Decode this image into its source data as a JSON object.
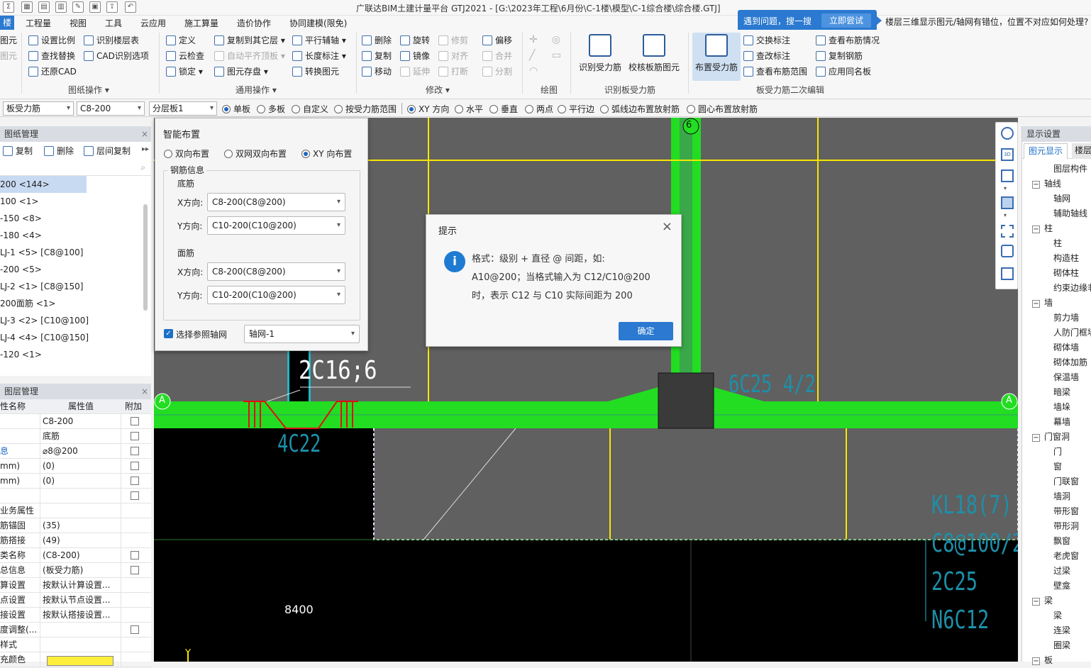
{
  "window_title": "广联达BIM土建计量平台 GTJ2021 - [G:\\2023年工程\\6月份\\C-1楼\\模型\\C-1综合楼\\综合楼.GTJ]",
  "quick_access_icons": [
    "sum-icon",
    "grid-icon",
    "table-icon",
    "table2-icon",
    "draw-icon",
    "save-icon",
    "export-icon",
    "undo-icon"
  ],
  "menu": {
    "items": [
      "楼",
      "工程量",
      "视图",
      "工具",
      "云应用",
      "施工算量",
      "造价协作",
      "协同建模(限免)"
    ]
  },
  "help_banner": {
    "text": "遇到问题，搜一搜",
    "button": "立即尝试",
    "question": "楼层三维显示图元/轴网有错位，位置不对应如何处理?"
  },
  "ribbon": {
    "left_partial": [
      "图元",
      "图元"
    ],
    "drawing_ops": {
      "items": [
        "设置比例",
        "识别楼层表",
        "查找替换",
        "CAD识别选项",
        "还原CAD"
      ],
      "label": "图纸操作"
    },
    "common_ops": {
      "items": [
        "定义",
        "复制到其它层",
        "平行辅轴",
        "云检查",
        "自动平齐顶板",
        "长度标注",
        "锁定",
        "图元存盘",
        "转换图元"
      ],
      "label": "通用操作"
    },
    "modify": {
      "items": [
        "删除",
        "旋转",
        "修剪",
        "偏移",
        "复制",
        "镜像",
        "对齐",
        "合并",
        "移动",
        "延伸",
        "打断",
        "分割"
      ],
      "label": "修改"
    },
    "draw": {
      "label": "绘图"
    },
    "identify": {
      "items": [
        "识别受力筋",
        "校核板筋图元"
      ],
      "label": "识别板受力筋"
    },
    "edit2": {
      "items": [
        "布置受力筋",
        "交换标注",
        "查看布筋情况",
        "查改标注",
        "复制钢筋",
        "查看布筋范围",
        "应用同名板"
      ],
      "label": "板受力筋二次编辑"
    }
  },
  "toolbar2": {
    "type_select": "板受力筋",
    "spec_select": "C8-200",
    "layer_select": "分层板1",
    "options": [
      "单板",
      "多板",
      "自定义",
      "按受力筋范围",
      "XY 方向",
      "水平",
      "垂直",
      "两点",
      "平行边",
      "弧线边布置放射筋",
      "圆心布置放射筋"
    ]
  },
  "drawing_mgmt": {
    "title": "图纸管理",
    "actions": [
      "复制",
      "删除",
      "层间复制"
    ],
    "items": [
      "200 <144>",
      "100 <1>",
      "-150 <8>",
      "-180 <4>",
      "LJ-1 <5> [C8@100]",
      "-200 <5>",
      "LJ-2 <1> [C8@150]",
      "200面筋 <1>",
      "LJ-3 <2> [C10@100]",
      "LJ-4 <4> [C10@150]",
      "-120 <1>"
    ]
  },
  "layer_mgmt": {
    "title": "图层管理",
    "headers": [
      "性名称",
      "属性值",
      "附加"
    ],
    "rows": [
      [
        "",
        "C8-200"
      ],
      [
        "",
        "底筋"
      ],
      [
        "息",
        "⌀8@200"
      ],
      [
        "mm)",
        "(0)"
      ],
      [
        "mm)",
        "(0)"
      ],
      [
        "",
        ""
      ],
      [
        "业务属性",
        ""
      ],
      [
        "筋锚固",
        "(35)"
      ],
      [
        "筋搭接",
        "(49)"
      ],
      [
        "类名称",
        "(C8-200)"
      ],
      [
        "总信息",
        "(板受力筋)"
      ],
      [
        "算设置",
        "按默认计算设置..."
      ],
      [
        "点设置",
        "按默认节点设置..."
      ],
      [
        "接设置",
        "按默认搭接设置..."
      ],
      [
        "度调整(...",
        ""
      ],
      [
        "样式",
        ""
      ],
      [
        "充颜色",
        ""
      ]
    ]
  },
  "smart_layout": {
    "title": "智能布置",
    "modes": [
      "双向布置",
      "双网双向布置",
      "XY 向布置"
    ],
    "rebar_info": "钢筋信息",
    "bottom": "底筋",
    "top": "面筋",
    "x_label": "X方向:",
    "y_label": "Y方向:",
    "bottom_x": "C8-200(C8@200)",
    "bottom_y": "C10-200(C10@200)",
    "top_x": "C8-200(C8@200)",
    "top_y": "C10-200(C10@200)",
    "ref_axis_label": "选择参照轴网",
    "ref_axis_value": "轴网-1"
  },
  "prompt": {
    "title": "提示",
    "line1": "格式：级别 + 直径 @ 间距，如:",
    "line2": "A10@200；当格式输入为 C12/C10@200",
    "line3": "时，表示 C12 与 C10 实际间距为 200",
    "ok": "确定"
  },
  "cad": {
    "axis_6": "6",
    "axis_a_left": "A",
    "axis_a_right": "A",
    "label_2c16": "2C16;6",
    "label_4c22": "4C22",
    "label_6c25": "6C25 4/2",
    "dimension": "8400",
    "kl_lines": [
      "KL18(7)",
      "C8@100/2",
      "2C25",
      "N6C12"
    ],
    "y_axis": "Y"
  },
  "display_settings": {
    "title": "显示设置",
    "tabs": [
      "图元显示",
      "楼层"
    ],
    "header": "图层构件",
    "tree": [
      {
        "group": "轴线",
        "items": [
          "轴网",
          "辅助轴线"
        ]
      },
      {
        "group": "柱",
        "items": [
          "柱",
          "构造柱",
          "砌体柱",
          "约束边缘非"
        ]
      },
      {
        "group": "墙",
        "items": [
          "剪力墙",
          "人防门框墙",
          "砌体墙",
          "砌体加筋",
          "保温墙",
          "暗梁",
          "墙垛",
          "幕墙"
        ]
      },
      {
        "group": "门窗洞",
        "items": [
          "门",
          "窗",
          "门联窗",
          "墙洞",
          "带形窗",
          "带形洞",
          "飘窗",
          "老虎窗",
          "过梁",
          "壁龛"
        ]
      },
      {
        "group": "梁",
        "items": [
          "梁",
          "连梁",
          "圈梁"
        ]
      },
      {
        "group": "板",
        "items": []
      }
    ]
  }
}
